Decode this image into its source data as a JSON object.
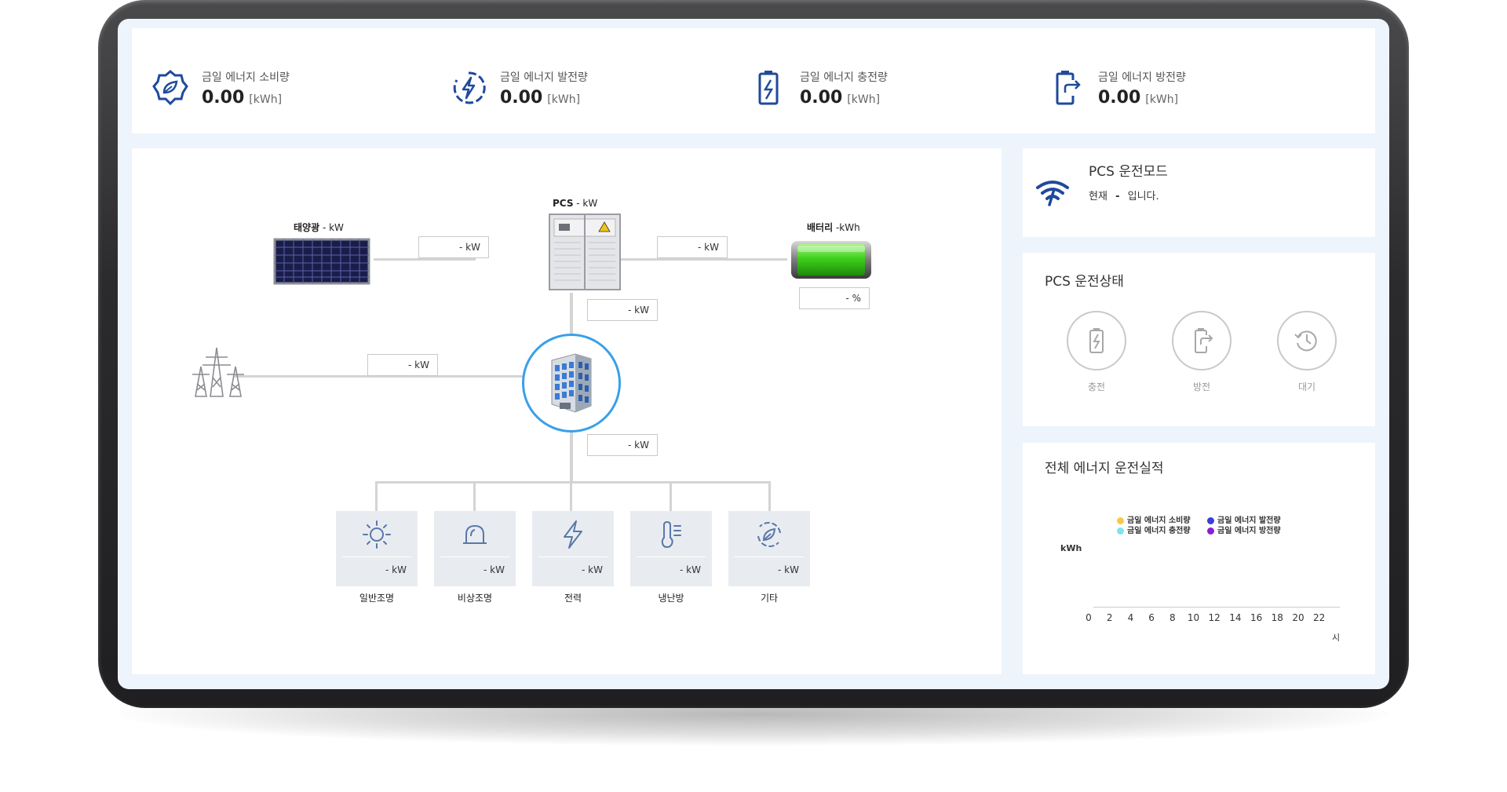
{
  "kpis": [
    {
      "label": "금일 에너지 소비량",
      "value": "0.00",
      "unit": "[kWh]",
      "icon": "leaf-badge-icon"
    },
    {
      "label": "금일 에너지 발전량",
      "value": "0.00",
      "unit": "[kWh]",
      "icon": "bolt-circle-icon"
    },
    {
      "label": "금일 에너지 충전량",
      "value": "0.00",
      "unit": "[kWh]",
      "icon": "battery-charge-icon"
    },
    {
      "label": "금일 에너지 방전량",
      "value": "0.00",
      "unit": "[kWh]",
      "icon": "battery-discharge-icon"
    }
  ],
  "diagram": {
    "solar_label": "태양광",
    "solar_value": " - kW",
    "pcs_label": "PCS",
    "pcs_value": " - kW",
    "battery_label": "배터리",
    "battery_value": " -kWh",
    "solar_to_pcs": "- kW",
    "pcs_to_battery": "- kW",
    "battery_soc": "- %",
    "pcs_to_building": "- kW",
    "grid_to_building": "- kW",
    "building_to_loads": "- kW",
    "loads": [
      {
        "name": "일반조명",
        "value": "- kW",
        "icon": "sun-icon"
      },
      {
        "name": "비상조명",
        "value": "- kW",
        "icon": "emergency-light-icon"
      },
      {
        "name": "전력",
        "value": "- kW",
        "icon": "lightning-icon"
      },
      {
        "name": "냉난방",
        "value": "- kW",
        "icon": "thermometer-icon"
      },
      {
        "name": "기타",
        "value": "- kW",
        "icon": "recycle-leaf-icon"
      }
    ]
  },
  "mode_panel": {
    "title": "PCS 운전모드",
    "status_prefix": "현재",
    "status_value": "-",
    "status_suffix": "입니다."
  },
  "state_panel": {
    "title": "PCS 운전상태",
    "states": [
      "충전",
      "방전",
      "대기"
    ]
  },
  "energy_panel": {
    "title": "전체 에너지 운전실적"
  },
  "chart_data": {
    "type": "bar",
    "title": "",
    "ylabel": "kWh",
    "xlabel": "시",
    "categories": [
      "0",
      "2",
      "4",
      "6",
      "8",
      "10",
      "12",
      "14",
      "16",
      "18",
      "20",
      "22"
    ],
    "series": [
      {
        "name": "금일 에너지 소비량",
        "color": "#f7c948",
        "values": []
      },
      {
        "name": "금일 에너지 발전량",
        "color": "#3b3fd8",
        "values": []
      },
      {
        "name": "금일 에너지 충전량",
        "color": "#7fe3f0",
        "values": []
      },
      {
        "name": "금일 에너지 방전량",
        "color": "#8a1ed6",
        "values": []
      }
    ],
    "legend": "top"
  }
}
